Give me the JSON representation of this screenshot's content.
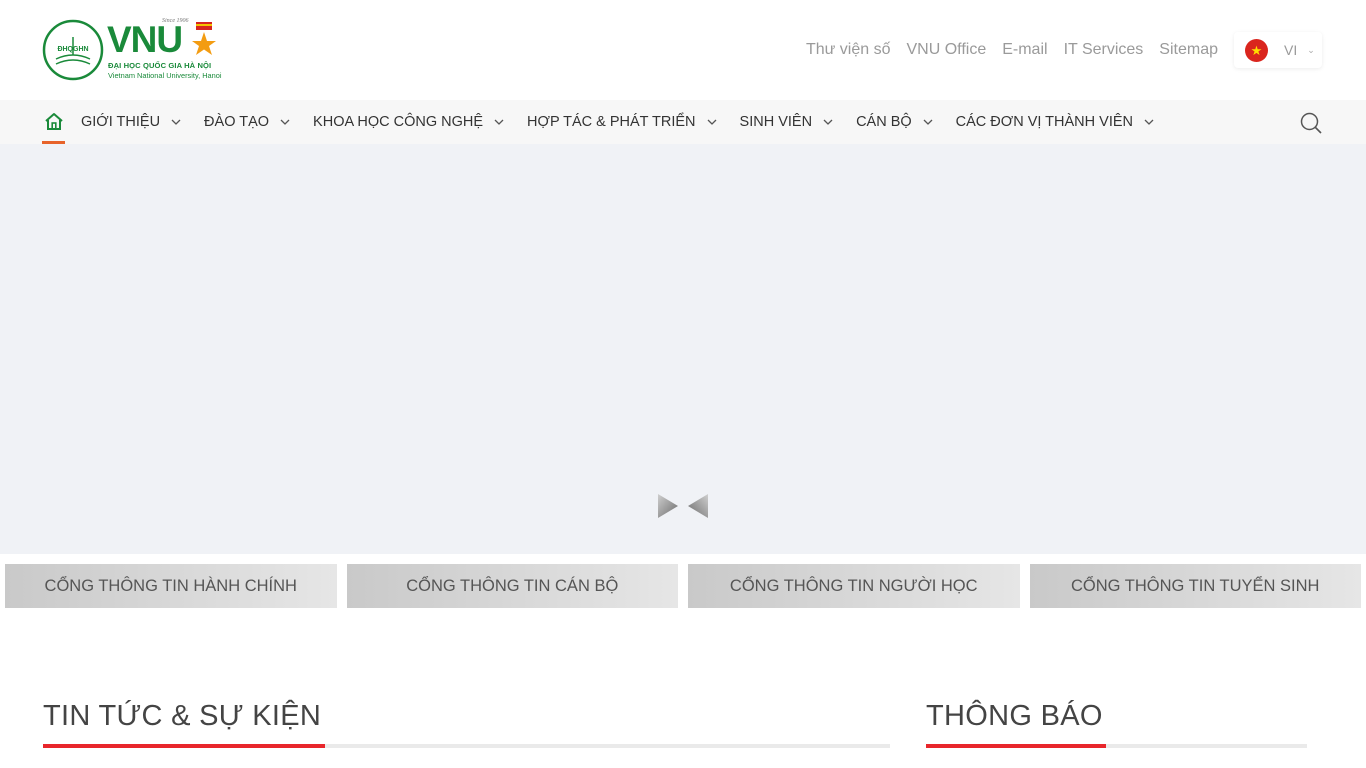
{
  "logo": {
    "badge_text": "ĐHQGHN",
    "wordmark": "VNU",
    "since": "Since 1906",
    "line1": "ĐẠI HỌC QUỐC GIA HÀ NỘI",
    "line2": "Vietnam National University, Hanoi",
    "brand_color": "#1a8a3a"
  },
  "top_links": [
    {
      "label": "Thư viện số"
    },
    {
      "label": "VNU Office"
    },
    {
      "label": "E-mail"
    },
    {
      "label": "IT Services"
    },
    {
      "label": "Sitemap"
    }
  ],
  "language": {
    "code": "VI",
    "flag_icon": "vietnam-flag-icon"
  },
  "nav": {
    "home_icon": "home-icon",
    "items": [
      {
        "label": "GIỚI THIỆU"
      },
      {
        "label": "ĐÀO TẠO"
      },
      {
        "label": "KHOA HỌC CÔNG NGHỆ"
      },
      {
        "label": "HỢP TÁC & PHÁT TRIỂN"
      },
      {
        "label": "SINH VIÊN"
      },
      {
        "label": "CÁN BỘ"
      },
      {
        "label": "CÁC ĐƠN VỊ THÀNH VIÊN"
      }
    ],
    "search_icon": "search-icon",
    "active_color": "#e7632a"
  },
  "portals": [
    {
      "label": "CỔNG THÔNG TIN HÀNH CHÍNH"
    },
    {
      "label": "CỔNG THÔNG TIN CÁN BỘ"
    },
    {
      "label": "CỔNG THÔNG TIN NGƯỜI HỌC"
    },
    {
      "label": "CỔNG THÔNG TIN TUYỂN SINH"
    }
  ],
  "sections": {
    "news_title": "TIN TỨC & SỰ KIỆN",
    "notice_title": "THÔNG BÁO",
    "accent_color": "#e8262b"
  }
}
